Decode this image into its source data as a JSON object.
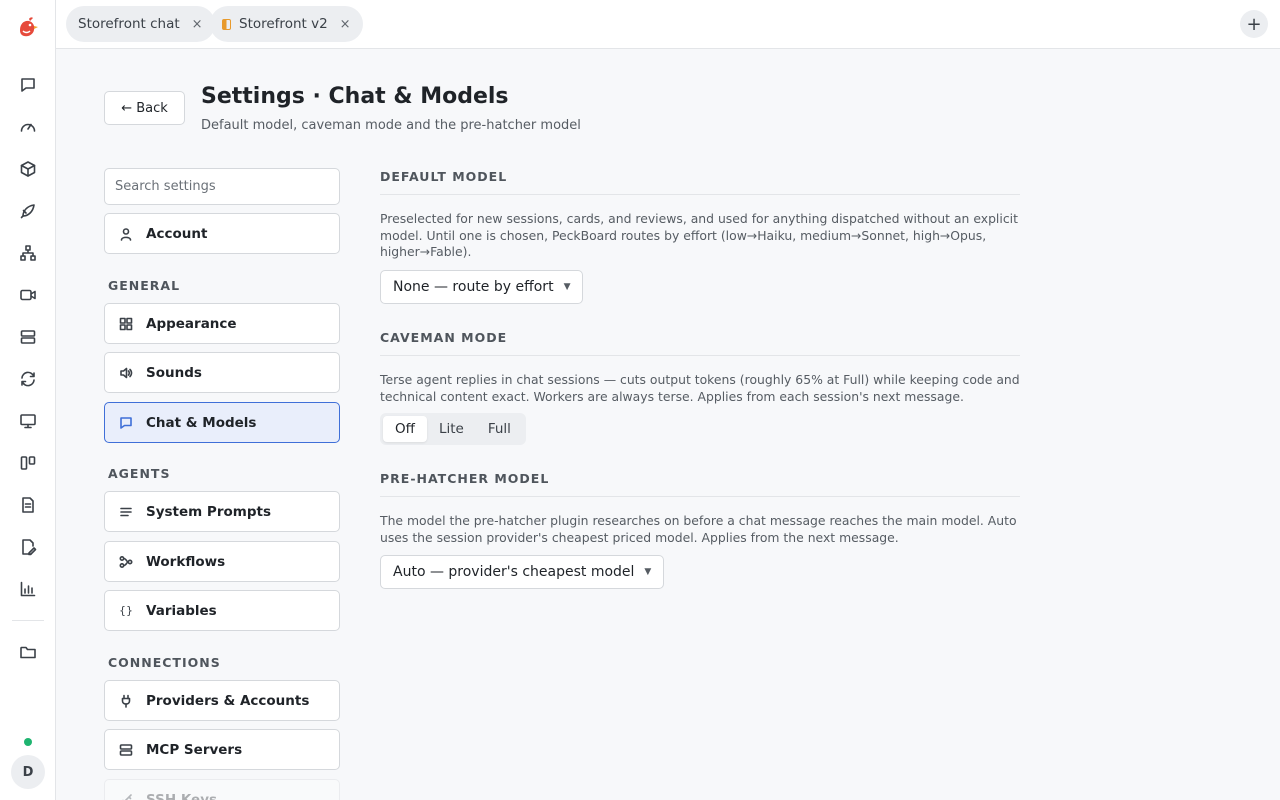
{
  "tabs": [
    {
      "label": "Storefront chat"
    },
    {
      "label": "Storefront v2"
    }
  ],
  "new_tab_label": "+",
  "tab_close_glyph": "×",
  "rail": {
    "icons": [
      "chat-icon",
      "dashboard-icon",
      "package-icon",
      "rocket-icon",
      "hierarchy-icon",
      "video-icon",
      "server-icon",
      "sync-icon",
      "monitor-icon",
      "board-icon",
      "document-icon",
      "edit-document-icon",
      "bar-chart-icon",
      "folder-icon"
    ],
    "status_color": "#1fb470",
    "avatar_initial": "D"
  },
  "header": {
    "back_label": "← Back",
    "title": "Settings · Chat & Models",
    "subtitle": "Default model, caveman mode and the pre-hatcher model"
  },
  "nav": {
    "search_placeholder": "Search settings",
    "account": "Account",
    "sections": {
      "general": "GENERAL",
      "agents": "AGENTS",
      "connections": "CONNECTIONS"
    },
    "items": {
      "appearance": "Appearance",
      "sounds": "Sounds",
      "chat_models": "Chat & Models",
      "system_prompts": "System Prompts",
      "workflows": "Workflows",
      "variables": "Variables",
      "providers": "Providers & Accounts",
      "mcp": "MCP Servers",
      "ssh": "SSH Keys"
    },
    "active_item": "Chat & Models",
    "accent_color": "#3f6fd8"
  },
  "default_model": {
    "heading": "DEFAULT MODEL",
    "description": "Preselected for new sessions, cards, and reviews, and used for anything dispatched without an explicit model. Until one is chosen, PeckBoard routes by effort (low→Haiku, medium→Sonnet, high→Opus, higher→Fable).",
    "value": "None — route by effort"
  },
  "caveman_mode": {
    "heading": "CAVEMAN MODE",
    "description": "Terse agent replies in chat sessions — cuts output tokens (roughly 65% at Full) while keeping code and technical content exact. Workers are always terse. Applies from each session's next message.",
    "options": [
      "Off",
      "Lite",
      "Full"
    ],
    "selected": "Off"
  },
  "pre_hatcher": {
    "heading": "PRE-HATCHER MODEL",
    "description": "The model the pre-hatcher plugin researches on before a chat message reaches the main model. Auto uses the session provider's cheapest priced model. Applies from the next message.",
    "value": "Auto — provider's cheapest model"
  }
}
